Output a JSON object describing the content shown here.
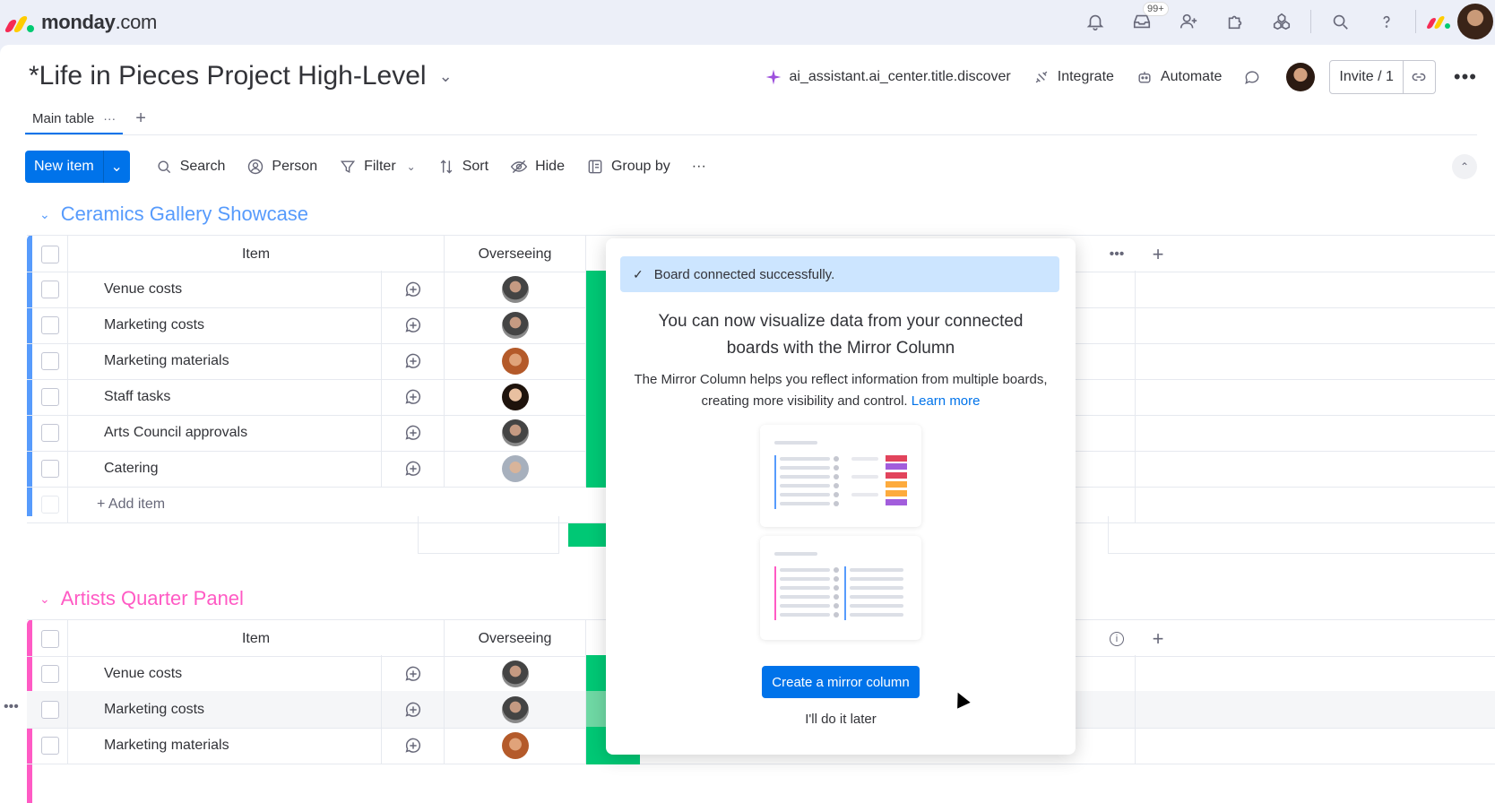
{
  "app": {
    "logo_text": "monday",
    "logo_suffix": ".com",
    "notifications_badge": "99+"
  },
  "header": {
    "title": "*Life in Pieces Project High-Level",
    "actions": {
      "ai": "ai_assistant.ai_center.title.discover",
      "integrate": "Integrate",
      "automate": "Automate",
      "invite": "Invite / 1"
    }
  },
  "tabs": [
    {
      "label": "Main table",
      "more": "···"
    }
  ],
  "tab_add": "+",
  "toolbar": {
    "new_item": "New item",
    "search": "Search",
    "person": "Person",
    "filter": "Filter",
    "sort": "Sort",
    "hide": "Hide",
    "group_by": "Group by",
    "more": "···"
  },
  "groups": [
    {
      "title": "Ceramics Gallery Showcase",
      "color": "#579bfc",
      "columns": {
        "item": "Item",
        "owner": "Overseeing"
      },
      "rows": [
        "Venue costs",
        "Marketing costs",
        "Marketing materials",
        "Staff tasks",
        "Arts Council approvals",
        "Catering"
      ],
      "add_item": "+ Add item"
    },
    {
      "title": "Artists Quarter Panel",
      "color": "#ff5ac4",
      "columns": {
        "item": "Item",
        "owner": "Overseeing"
      },
      "rows": [
        "Venue costs",
        "Marketing costs",
        "Marketing materials"
      ]
    }
  ],
  "popover": {
    "toast": "Board connected successfully.",
    "title": "You can now visualize data from your connected boards with the Mirror Column",
    "description": "The Mirror Column helps you reflect information from multiple boards, creating more visibility and control.",
    "learn_more": "Learn more",
    "cta": "Create a mirror column",
    "later": "I'll do it later"
  },
  "colors": {
    "accent": "#0073ea",
    "status_done": "#00c875"
  }
}
